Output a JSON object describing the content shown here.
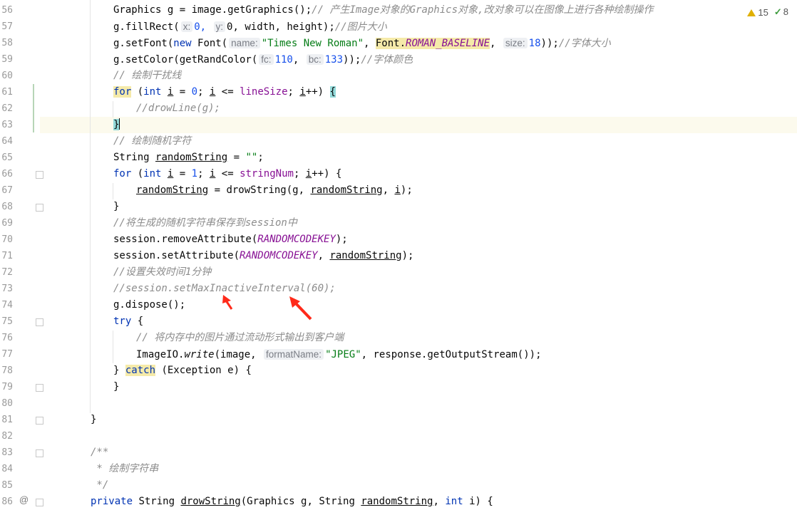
{
  "editor": {
    "line_numbers": [
      "56",
      "57",
      "58",
      "59",
      "60",
      "61",
      "62",
      "63",
      "64",
      "65",
      "66",
      "67",
      "68",
      "69",
      "70",
      "71",
      "72",
      "73",
      "74",
      "75",
      "76",
      "77",
      "78",
      "79",
      "80",
      "81",
      "82",
      "83",
      "84",
      "85",
      "86"
    ],
    "inspections": {
      "warnings": "15",
      "ok": "8"
    },
    "hints": {
      "x": "x:",
      "y": "y:",
      "name": "name:",
      "size": "size:",
      "fc": "fc:",
      "bc": "bc:",
      "formatName": "formatName:"
    },
    "lines": {
      "l56a": "Graphics g = image.getGraphics();",
      "l56c": "// 产生Image对象的Graphics对象,改对象可以在图像上进行各种绘制操作",
      "l57a": "g.fillRect(",
      "l57b": "0,",
      "l57c": "0, width, height);",
      "l57d": "//图片大小",
      "l58a": "g.setFont(",
      "l58b": "new",
      "l58c": " Font(",
      "l58d": "\"Times New Roman\"",
      "l58e": "Font.",
      "l58f": "ROMAN_BASELINE",
      "l58g": "18));",
      "l58h": "//字体大小",
      "l59a": "g.setColor(getRandColor(",
      "l59b": "110,",
      "l59c": "133));",
      "l59d": "//字体颜色",
      "l60": "// 绘制干扰线",
      "l61a": "for",
      "l61b": "int",
      "l61c": "lineSize",
      "l62": "//drowLine(g);",
      "l64": "// 绘制随机字符",
      "l65a": "String ",
      "l65b": "randomString",
      "l65c": " = ",
      "l65d": "\"\"",
      "l66c": "stringNum",
      "l67a": "randomString",
      "l67b": " = drowString(g, ",
      "l67c": "randomString",
      "l67d": ", ",
      "l67e": "i",
      "l67f": ");",
      "l69": "//将生成的随机字符串保存到session中",
      "l70a": "session.removeAttribute(",
      "l70b": "RANDOMCODEKEY",
      "l70c": ");",
      "l71a": "session.setAttribute(",
      "l71b": "RANDOMCODEKEY",
      "l71c": ", ",
      "l71d": "randomString",
      "l71e": ");",
      "l72": "//设置失效时间1分钟",
      "l73": "//session.setMaxInactiveInterval(60);",
      "l74": "g.dispose();",
      "l75a": "try",
      "l75b": " {",
      "l76": "// 将内存中的图片通过流动形式输出到客户端",
      "l77a": "ImageIO.",
      "l77b": "write",
      "l77c": "(image, ",
      "l77d": "\"JPEG\"",
      "l77e": ", response.getOutputStream());",
      "l78a": "} ",
      "l78b": "catch",
      "l78c": " (Exception e) {",
      "l79": "}",
      "l81": "}",
      "l83": "/**",
      "l84": " * 绘制字符串",
      "l85": " */",
      "l86a": "private",
      "l86b": " String ",
      "l86c": "drowString",
      "l86d": "(Graphics g, String ",
      "l86e": "randomString",
      "l86f": ", ",
      "l86g": "int",
      "l86h": " i) {"
    }
  },
  "annotation_color": "#ff2a1a"
}
